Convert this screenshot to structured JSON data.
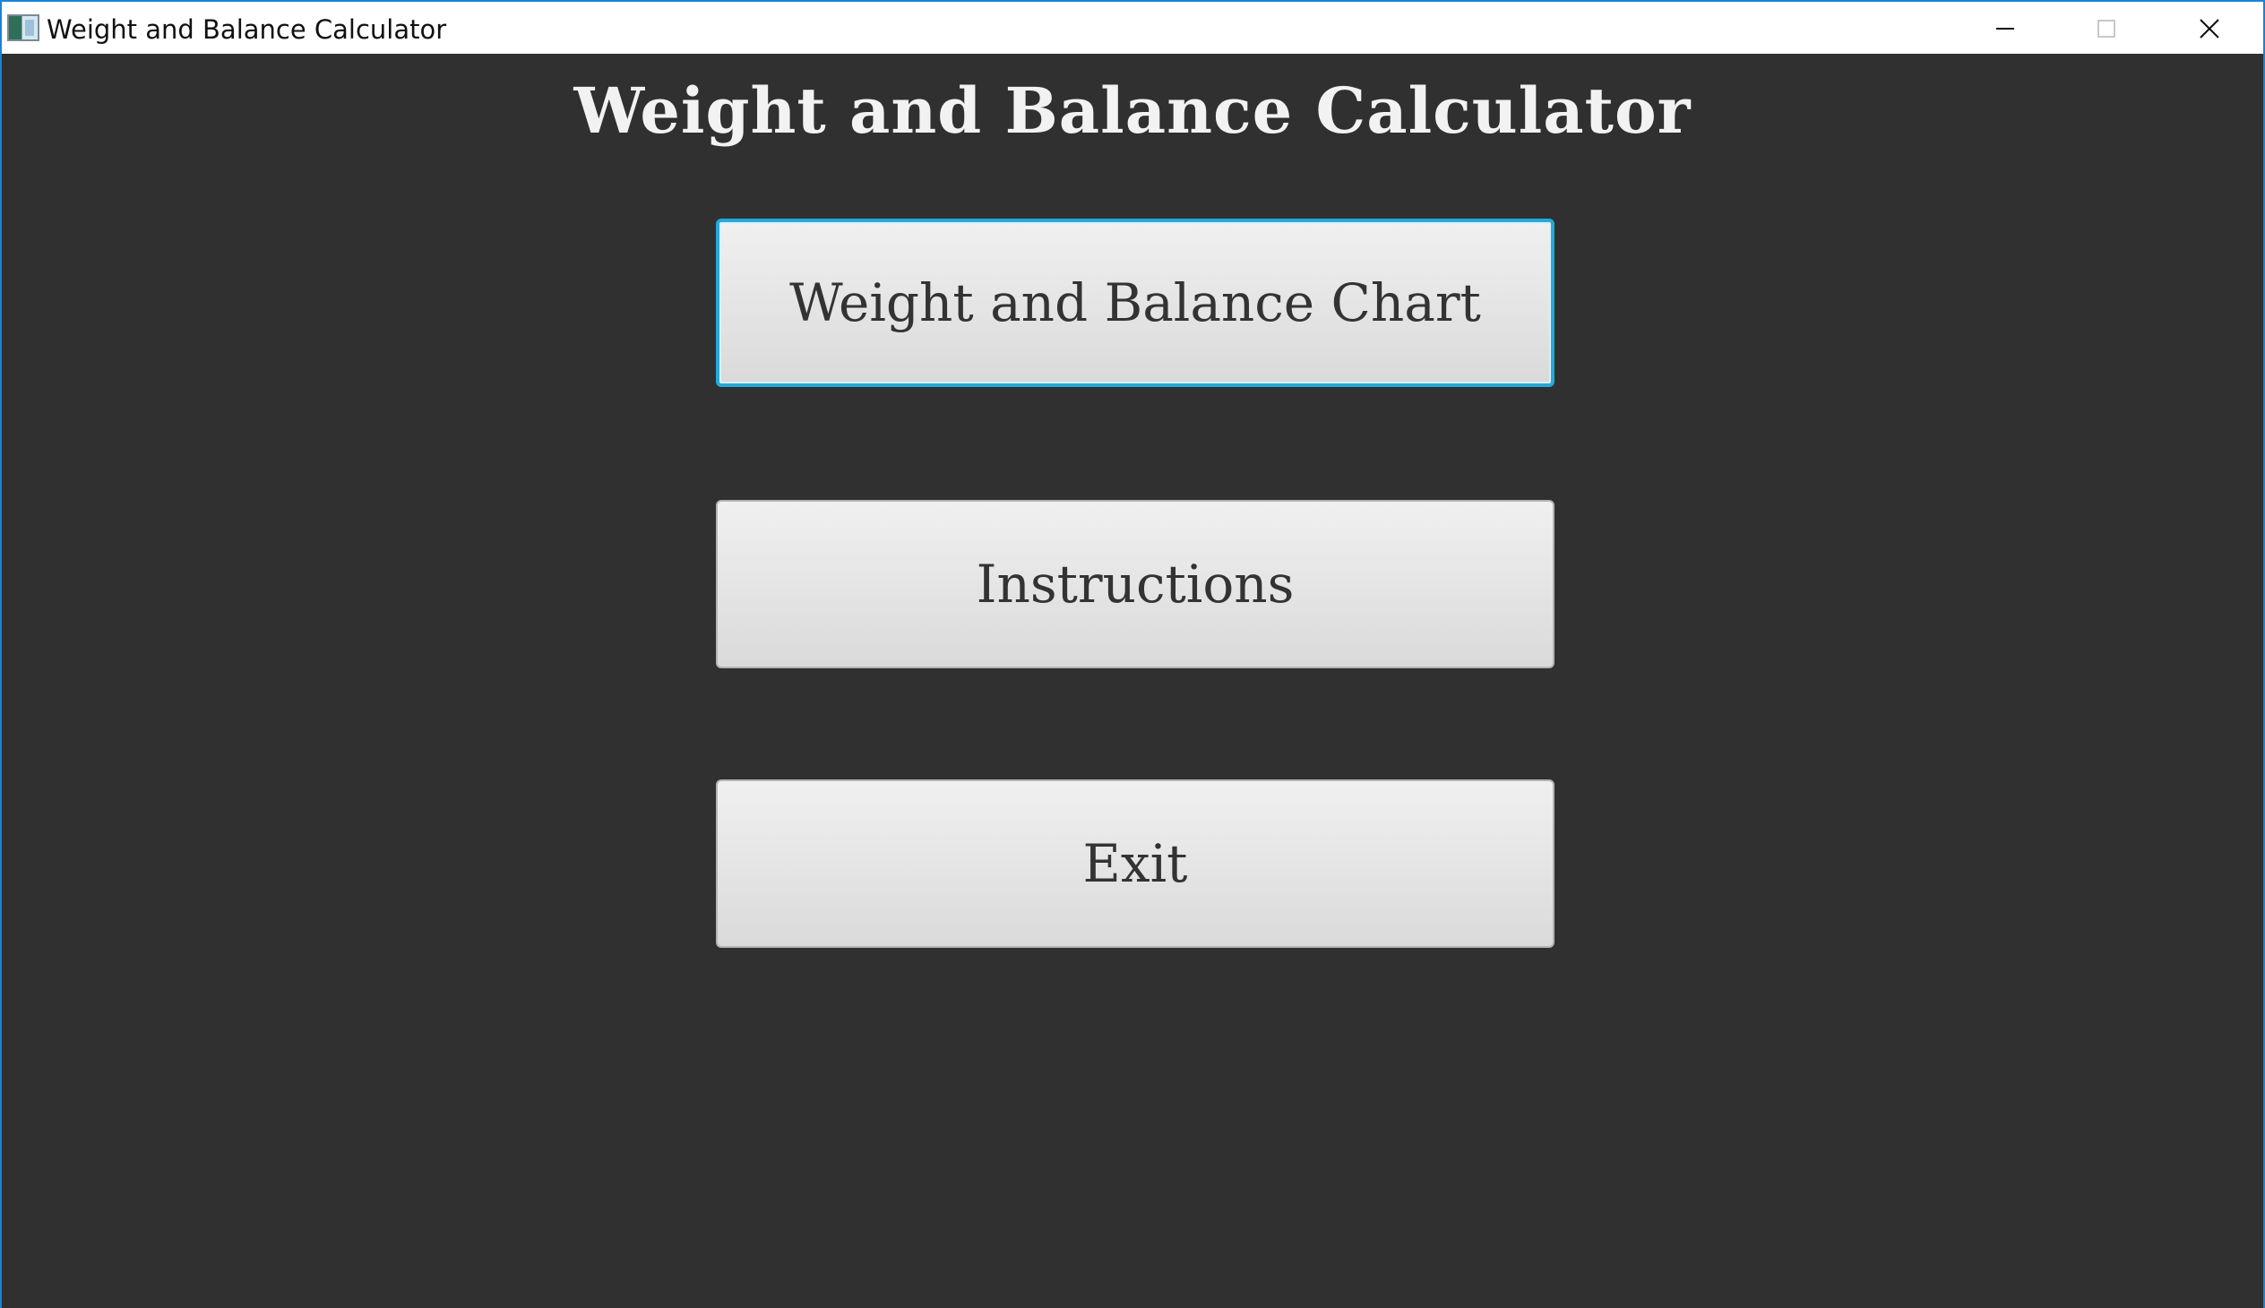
{
  "window": {
    "title": "Weight and Balance Calculator",
    "controls": {
      "minimize_icon": "minimize-icon",
      "maximize_icon": "maximize-icon",
      "close_icon": "close-icon"
    }
  },
  "main": {
    "title": "Weight and Balance Calculator",
    "buttons": [
      {
        "label": "Weight and Balance Chart",
        "focused": true
      },
      {
        "label": "Instructions",
        "focused": false
      },
      {
        "label": "Exit",
        "focused": false
      }
    ]
  },
  "colors": {
    "background": "#303030",
    "button_text": "#333333",
    "title_text": "#f2f2f2",
    "focus_accent": "#25a9d8",
    "window_border": "#1883d7"
  }
}
